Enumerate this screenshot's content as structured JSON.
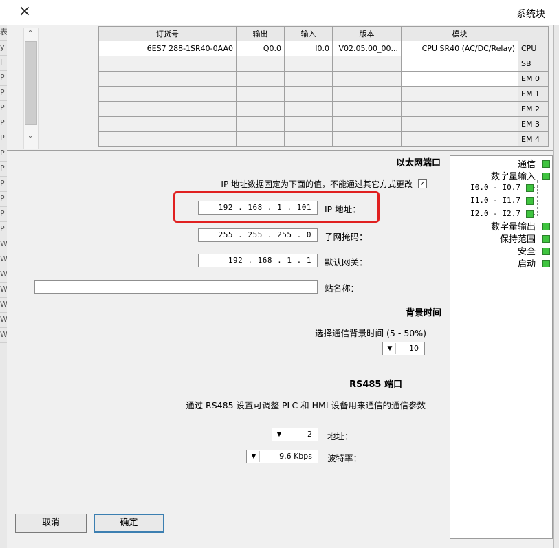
{
  "window": {
    "title": "系统块",
    "close_icon": "×"
  },
  "left_strip": [
    "表",
    "y",
    "I",
    "P",
    "P",
    "P",
    "P",
    "P",
    "P",
    "P",
    "P",
    "P",
    "P",
    "P",
    "W",
    "W",
    "W",
    "W",
    "W",
    "W",
    "W"
  ],
  "module_table": {
    "headers": [
      "模块",
      "版本",
      "输入",
      "输出",
      "订货号"
    ],
    "rows": [
      {
        "slot": "CPU",
        "module": "CPU SR40 (AC/DC/Relay)",
        "version": "V02.05.00_00...",
        "input": "I0.0",
        "output": "Q0.0",
        "order": "6ES7 288-1SR40-0AA0"
      },
      {
        "slot": "SB",
        "module": "",
        "version": "",
        "input": "",
        "output": "",
        "order": ""
      },
      {
        "slot": "EM 0",
        "module": "",
        "version": "",
        "input": "",
        "output": "",
        "order": ""
      },
      {
        "slot": "EM 1",
        "module": "",
        "version": "",
        "input": "",
        "output": "",
        "order": ""
      },
      {
        "slot": "EM 2",
        "module": "",
        "version": "",
        "input": "",
        "output": "",
        "order": ""
      },
      {
        "slot": "EM 3",
        "module": "",
        "version": "",
        "input": "",
        "output": "",
        "order": ""
      },
      {
        "slot": "EM 4",
        "module": "",
        "version": "",
        "input": "",
        "output": "",
        "order": ""
      }
    ]
  },
  "ethernet": {
    "section_title": "以太网端口",
    "fixed_ip_checkbox_label": "IP 地址数据固定为下面的值，不能通过其它方式更改",
    "fixed_ip_checked": true,
    "ip_label": "IP 地址：",
    "ip_value": "192 . 168 .  1  . 101",
    "subnet_label": "子网掩码：",
    "subnet_value": "255 . 255 . 255 .  0",
    "gateway_label": "默认网关：",
    "gateway_value": "192 . 168 .  1  .  1",
    "station_label": "站名称：",
    "station_value": ""
  },
  "background": {
    "section_title": "背景时间",
    "desc": "选择通信背景时间 (5 - 50%)",
    "value": "10"
  },
  "rs485": {
    "section_title": "RS485 端口",
    "desc": "通过 RS485 设置可调整 PLC 和 HMI 设备用来通信的通信参数",
    "address_label": "地址：",
    "address_value": "2",
    "baud_label": "波特率：",
    "baud_value": "9.6 Kbps"
  },
  "tree": {
    "items": [
      "通信",
      "数字量输入",
      "数字量输出",
      "保持范围",
      "安全",
      "启动"
    ],
    "sub_items": [
      "I0.0 - I0.7",
      "I1.0 - I1.7",
      "I2.0 - I2.7"
    ]
  },
  "buttons": {
    "ok": "确定",
    "cancel": "取消"
  },
  "colors": {
    "highlight": "#e02020",
    "status_green": "#3fc43f"
  }
}
